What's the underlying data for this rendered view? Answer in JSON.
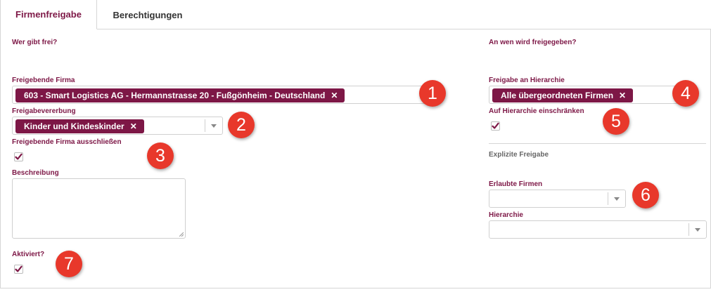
{
  "tabs": [
    {
      "label": "Firmenfreigabe",
      "active": true
    },
    {
      "label": "Berechtigungen",
      "active": false
    }
  ],
  "left": {
    "section_title": "Wer gibt frei?",
    "company_label": "Freigebende Firma",
    "company_value": "603 - Smart Logistics AG - Hermannstrasse 20 - Fußgönheim - Deutschland",
    "inheritance_label": "Freigabevererbung",
    "inheritance_value": "Kinder und Kindeskinder",
    "exclude_label": "Freigebende Firma ausschließen",
    "exclude_checked": true,
    "description_label": "Beschreibung",
    "description_value": "",
    "active_label": "Aktiviert?",
    "active_checked": true
  },
  "right": {
    "section_title": "An wen wird freigegeben?",
    "hierarchy_label": "Freigabe an Hierarchie",
    "hierarchy_value": "Alle übergeordneten Firmen",
    "restrict_label": "Auf Hierarchie einschränken",
    "restrict_checked": true,
    "explicit_title": "Explizite Freigabe",
    "allowed_label": "Erlaubte Firmen",
    "allowed_value": "",
    "hierarchy2_label": "Hierarchie",
    "hierarchy2_value": ""
  },
  "markers": [
    "1",
    "2",
    "3",
    "4",
    "5",
    "6",
    "7"
  ],
  "colors": {
    "accent": "#7d1746",
    "marker": "#e8382b",
    "border": "#d6d6d6"
  },
  "icons": {
    "remove": "close-icon",
    "dropdown": "chevron-down-icon",
    "check": "checkmark-icon"
  }
}
